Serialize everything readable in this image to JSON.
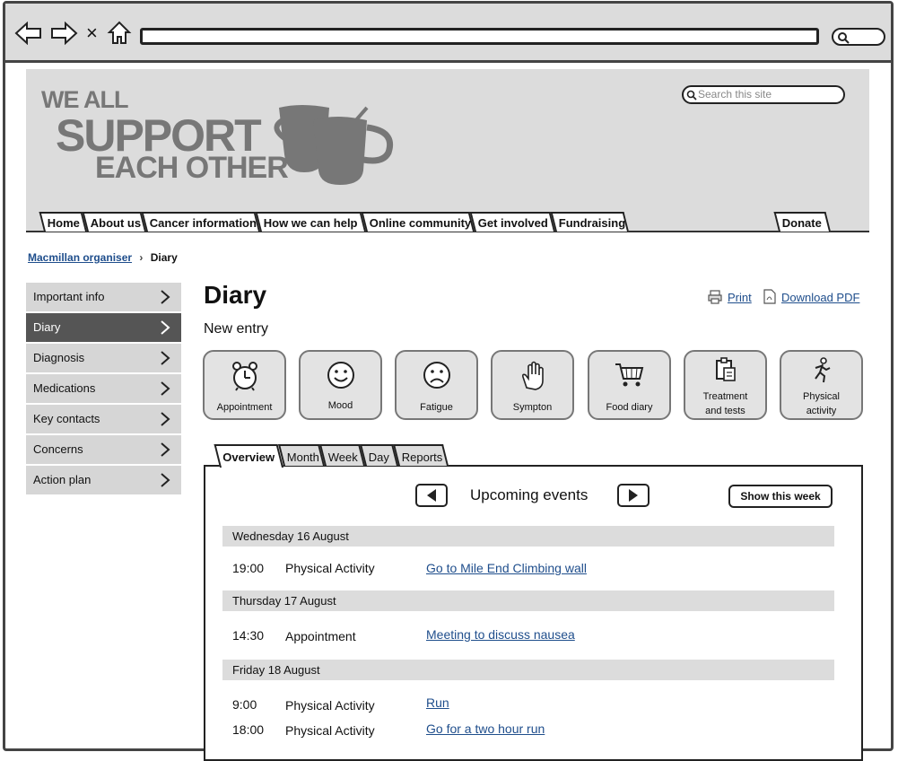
{
  "browser": {
    "back_icon": "left-arrow-icon",
    "forward_icon": "right-arrow-icon",
    "close_label": "×",
    "home_icon": "home-icon",
    "url": "",
    "search_icon": "magnifier-icon"
  },
  "header": {
    "logo_lines": [
      "WE ALL",
      "SUPPORT",
      "EACH OTHER"
    ],
    "search_placeholder": "Search this site",
    "nav": [
      "Home",
      "About us",
      "Cancer information",
      "How we can help",
      "Online community",
      "Get involved",
      "Fundraising"
    ],
    "donate": "Donate"
  },
  "breadcrumb": {
    "parent": "Macmillan organiser",
    "separator": "›",
    "current": "Diary"
  },
  "sidebar": {
    "items": [
      {
        "label": "Important info",
        "active": false
      },
      {
        "label": "Diary",
        "active": true
      },
      {
        "label": "Diagnosis",
        "active": false
      },
      {
        "label": "Medications",
        "active": false
      },
      {
        "label": "Key contacts",
        "active": false
      },
      {
        "label": "Concerns",
        "active": false
      },
      {
        "label": "Action plan",
        "active": false
      }
    ]
  },
  "main": {
    "title": "Diary",
    "subtitle": "New entry",
    "print": "Print",
    "download": "Download PDF",
    "entry_buttons": [
      {
        "label": "Appointment",
        "icon": "alarm-clock-icon"
      },
      {
        "label": "Mood",
        "icon": "smiley-icon"
      },
      {
        "label": "Fatigue",
        "icon": "sad-face-icon"
      },
      {
        "label": "Sympton",
        "icon": "hand-icon"
      },
      {
        "label": "Food diary",
        "icon": "shopping-cart-icon"
      },
      {
        "label_1": "Treatment",
        "label_2": "and tests",
        "icon": "clipboard-icon"
      },
      {
        "label_1": "Physical",
        "label_2": "activity",
        "icon": "running-person-icon"
      }
    ],
    "tabs": [
      "Overview",
      "Month",
      "Week",
      "Day",
      "Reports"
    ],
    "active_tab": "Overview",
    "upcoming": "Upcoming events",
    "show_week": "Show this week",
    "days": [
      {
        "date": "Wednesday 16 August",
        "events": [
          {
            "time": "19:00",
            "type": "Physical Activity",
            "link": "Go to Mile End Climbing wall"
          }
        ]
      },
      {
        "date": "Thursday 17 August",
        "events": [
          {
            "time": "14:30",
            "type": "Appointment",
            "link": "Meeting to discuss nausea"
          }
        ]
      },
      {
        "date": "Friday 18 August",
        "events": [
          {
            "time": "9:00",
            "type": "Physical Activity",
            "link": "Run"
          },
          {
            "time": "18:00",
            "type": "Physical Activity",
            "link": "Go for a two hour run"
          }
        ]
      }
    ]
  },
  "colors": {
    "link": "#1f4e8c",
    "active_sidebar": "#555555",
    "panel_grey": "#dcdcdc"
  }
}
